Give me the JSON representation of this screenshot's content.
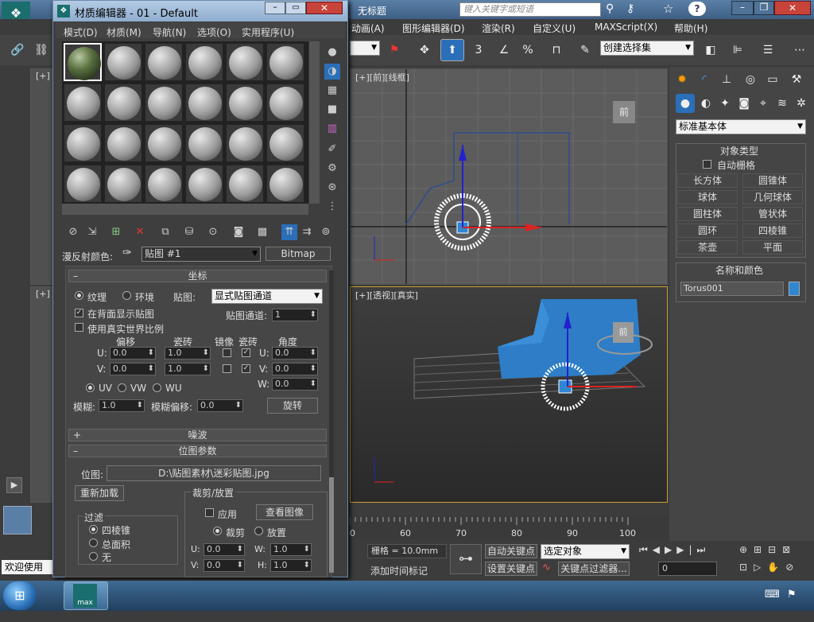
{
  "app": {
    "doc_title": "无标题",
    "search_placeholder": "键入关键字或短语",
    "menus": [
      "动画(A)",
      "图形编辑器(D)",
      "渲染(R)",
      "自定义(U)",
      "MAXScript(X)",
      "帮助(H)"
    ],
    "selection_set": "创建选择集",
    "toolbar_labels": {
      "snap3": "3",
      "percent": "%"
    }
  },
  "viewports": {
    "front": "[+][前][线框]",
    "persp": "[+][透视][真实]",
    "left_top": "[+]",
    "left_mid": "[+]",
    "viewcube": "前"
  },
  "command_panel": {
    "category": "标准基本体",
    "object_type_title": "对象类型",
    "autogrid": "自动栅格",
    "objects": [
      "长方体",
      "圆锥体",
      "球体",
      "几何球体",
      "圆柱体",
      "管状体",
      "圆环",
      "四棱锥",
      "茶壶",
      "平面"
    ],
    "name_color_title": "名称和颜色",
    "object_name": "Torus001",
    "object_color": "#2e86d4"
  },
  "timeline": {
    "ticks": [
      "0",
      "60",
      "70",
      "80",
      "90",
      "100"
    ]
  },
  "status": {
    "welcome": "欢迎使用",
    "grid": "栅格 = 10.0mm",
    "add_time_tag": "添加时间标记",
    "auto_key": "自动关键点",
    "set_key": "设置关键点",
    "key_mode": "选定对象",
    "key_filters": "关键点过滤器...",
    "frame": "0"
  },
  "mat_editor": {
    "title": "材质编辑器 - 01 - Default",
    "menus": [
      "模式(D)",
      "材质(M)",
      "导航(N)",
      "选项(O)",
      "实用程序(U)"
    ],
    "diffuse_label": "漫反射颜色:",
    "map_name": "贴图 #1",
    "map_type": "Bitmap",
    "coords_title": "坐标",
    "texture": "纹理",
    "environ": "环境",
    "mapping_label": "贴图:",
    "mapping_value": "显式贴图通道",
    "show_back": "在背面显示贴图",
    "map_channel_label": "贴图通道:",
    "map_channel": "1",
    "real_world": "使用真实世界比例",
    "col_offset": "偏移",
    "col_tiling": "瓷砖",
    "col_mirror": "镜像",
    "col_tile": "瓷砖",
    "col_angle": "角度",
    "u_label": "U:",
    "v_label": "V:",
    "w_label": "W:",
    "u_offset": "0.0",
    "v_offset": "0.0",
    "u_tiling": "1.0",
    "v_tiling": "1.0",
    "u_angle": "0.0",
    "v_angle": "0.0",
    "w_angle": "0.0",
    "uv": "UV",
    "vw": "VW",
    "wu": "WU",
    "blur_label": "模糊:",
    "blur": "1.0",
    "blur_offset_label": "模糊偏移:",
    "blur_offset": "0.0",
    "rotate": "旋转",
    "noise_title": "噪波",
    "bitmap_params_title": "位图参数",
    "bitmap_label": "位图:",
    "bitmap_path": "D:\\贴图素材\\迷彩贴图.jpg",
    "reload": "重新加载",
    "crop_title": "裁剪/放置",
    "apply": "应用",
    "view_image": "查看图像",
    "crop": "裁剪",
    "place": "放置",
    "filter_title": "过滤",
    "filter_pyramidal": "四棱锥",
    "filter_sat": "总面积",
    "filter_none": "无",
    "cu_label": "U:",
    "cu": "0.0",
    "cv_label": "V:",
    "cv": "0.0",
    "cw_label": "W:",
    "cw": "1.0",
    "ch_label": "H:",
    "ch": "1.0"
  },
  "taskbar": {
    "app_label": "max"
  }
}
